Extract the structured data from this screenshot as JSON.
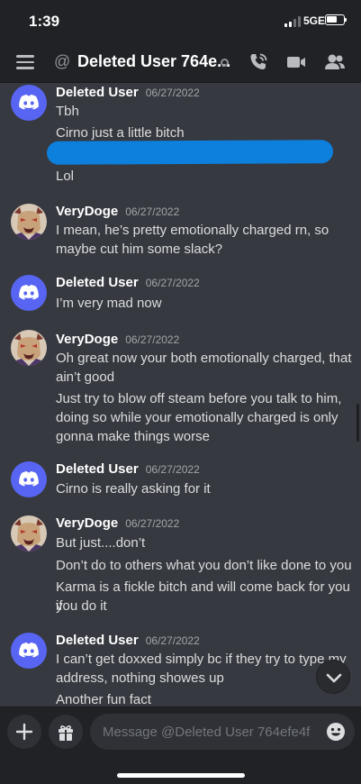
{
  "status_bar": {
    "time": "1:39",
    "network": "5GE",
    "signal_bars": 2,
    "signal_bars_total": 4
  },
  "header": {
    "at_symbol": "@",
    "title": "Deleted User 764e...",
    "status": "offline",
    "icons": [
      "hamburger-menu-icon",
      "call-icon",
      "video-call-icon",
      "members-icon"
    ]
  },
  "messages": [
    {
      "author": "Deleted User",
      "timestamp": "06/27/2022",
      "avatar": "discord-logo-icon",
      "lines": [
        "Tbh",
        "Cirno just a little bitch",
        "Lol"
      ],
      "has_redacted_line": true
    },
    {
      "author": "VeryDoge",
      "timestamp": "06/27/2022",
      "avatar": "anime-character-avatar",
      "lines": [
        "I mean, he’s pretty emotionally charged rn, so",
        "maybe cut him some slack?"
      ]
    },
    {
      "author": "Deleted User",
      "timestamp": "06/27/2022",
      "avatar": "discord-logo-icon",
      "lines": [
        "I’m very mad now"
      ]
    },
    {
      "author": "VeryDoge",
      "timestamp": "06/27/2022",
      "avatar": "anime-character-avatar",
      "lines": [
        "Oh great now your both emotionally charged, that",
        "ain’t good",
        "Just try to blow off steam before you talk to him,",
        "doing so while your emotionally charged is only",
        "gonna make things worse"
      ]
    },
    {
      "author": "Deleted User",
      "timestamp": "06/27/2022",
      "avatar": "discord-logo-icon",
      "lines": [
        "Cirno is really asking for it"
      ]
    },
    {
      "author": "VeryDoge",
      "timestamp": "06/27/2022",
      "avatar": "anime-character-avatar",
      "lines": [
        "But just....don’t",
        "Don’t do to others what you don’t like done to you",
        "Karma is a fickle bitch and will come back for you if",
        "you do it"
      ]
    },
    {
      "author": "Deleted User",
      "timestamp": "06/27/2022",
      "avatar": "discord-logo-icon",
      "lines": [
        "I can’t get doxxed simply bc if they try to type my",
        "address, nothing showes up",
        "Another fun fact"
      ]
    }
  ],
  "composer": {
    "placeholder": "Message @Deleted User 764efe4f",
    "value": ""
  },
  "colors": {
    "background": "#36393f",
    "bars": "#202225",
    "blurple": "#5865f2",
    "redaction": "#0d7fdc"
  }
}
